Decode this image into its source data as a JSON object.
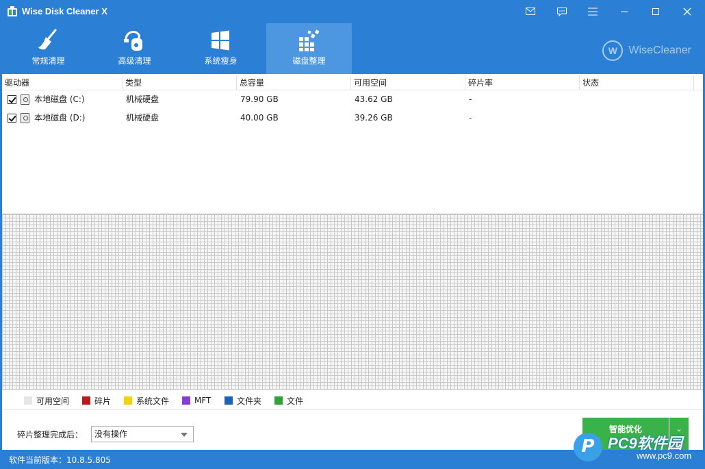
{
  "window": {
    "title": "Wise Disk Cleaner X",
    "titlebar_icons": [
      "mail-icon",
      "feedback-icon",
      "menu-icon",
      "minimize-icon",
      "maximize-icon",
      "close-icon"
    ]
  },
  "nav": {
    "tabs": [
      {
        "label": "常规清理",
        "icon": "broom-icon"
      },
      {
        "label": "高级清理",
        "icon": "vacuum-icon"
      },
      {
        "label": "系统瘦身",
        "icon": "windows-icon"
      },
      {
        "label": "磁盘整理",
        "icon": "defrag-icon",
        "active": true
      }
    ],
    "brand": "WiseCleaner",
    "brand_logo": "W"
  },
  "table": {
    "columns": [
      "驱动器",
      "类型",
      "总容量",
      "可用空间",
      "碎片率",
      "状态"
    ],
    "rows": [
      {
        "checked": true,
        "drive": "本地磁盘 (C:)",
        "type": "机械硬盘",
        "total": "79.90 GB",
        "free": "43.62 GB",
        "frag": "-",
        "status": ""
      },
      {
        "checked": true,
        "drive": "本地磁盘 (D:)",
        "type": "机械硬盘",
        "total": "40.00 GB",
        "free": "39.26 GB",
        "frag": "-",
        "status": ""
      }
    ]
  },
  "legend": [
    {
      "label": "可用空间",
      "color": "#e6e6e6"
    },
    {
      "label": "碎片",
      "color": "#b81d1d"
    },
    {
      "label": "系统文件",
      "color": "#f5d20e"
    },
    {
      "label": "MFT",
      "color": "#8a3ad6"
    },
    {
      "label": "文件夹",
      "color": "#1c63b8"
    },
    {
      "label": "文件",
      "color": "#2fa33a"
    }
  ],
  "actions": {
    "after_label": "碎片整理完成后：",
    "after_value": "没有操作",
    "optimize_label": "智能优化",
    "optimize_dropdown": "⌄"
  },
  "status": {
    "version": "软件当前版本：10.8.5.805"
  },
  "watermark": {
    "badge": "P",
    "name": "PC9软件园",
    "url": "www.pc9.com"
  },
  "colors": {
    "accent": "#2b7fd4",
    "active_tab": "#4d97e0",
    "optimize": "#3ab24a"
  }
}
